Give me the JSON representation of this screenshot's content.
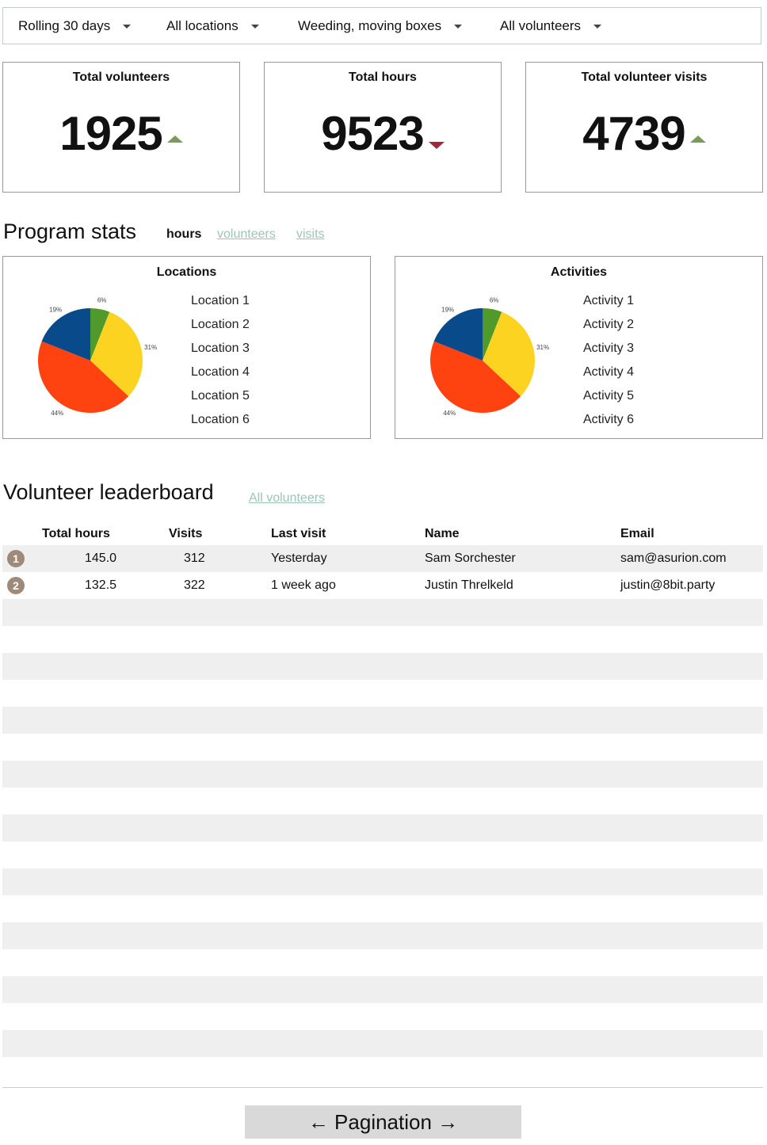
{
  "filters": [
    {
      "label": "Rolling 30 days"
    },
    {
      "label": "All locations"
    },
    {
      "label": "Weeding, moving boxes"
    },
    {
      "label": "All volunteers"
    }
  ],
  "stats": [
    {
      "title": "Total volunteers",
      "value": "1925",
      "trend": "up"
    },
    {
      "title": "Total hours",
      "value": "9523",
      "trend": "down"
    },
    {
      "title": "Total volunteer visits",
      "value": "4739",
      "trend": "up"
    }
  ],
  "program_stats": {
    "title": "Program stats",
    "tabs": [
      {
        "label": "hours",
        "active": true
      },
      {
        "label": "volunteers",
        "active": false
      },
      {
        "label": "visits",
        "active": false
      }
    ],
    "locations": {
      "title": "Locations",
      "legend": [
        "Location 1",
        "Location 2",
        "Location 3",
        "Location 4",
        "Location 5",
        "Location 6"
      ],
      "slices": [
        {
          "label": "6%",
          "value": 6,
          "color": "#4f9a2a"
        },
        {
          "label": "31%",
          "value": 31,
          "color": "#fdd322"
        },
        {
          "label": "44%",
          "value": 44,
          "color": "#fe4310"
        },
        {
          "label": "19%",
          "value": 19,
          "color": "#094a8a"
        }
      ]
    },
    "activities": {
      "title": "Activities",
      "legend": [
        "Activity 1",
        "Activity 2",
        "Activity 3",
        "Activity 4",
        "Activity 5",
        "Activity 6"
      ],
      "slices": [
        {
          "label": "6%",
          "value": 6,
          "color": "#4f9a2a"
        },
        {
          "label": "31%",
          "value": 31,
          "color": "#fdd322"
        },
        {
          "label": "44%",
          "value": 44,
          "color": "#fe4310"
        },
        {
          "label": "19%",
          "value": 19,
          "color": "#094a8a"
        }
      ]
    }
  },
  "leaderboard": {
    "title": "Volunteer leaderboard",
    "link": "All volunteers",
    "headers": {
      "total_hours": "Total hours",
      "visits": "Visits",
      "last_visit": "Last visit",
      "name": "Name",
      "email": "Email"
    },
    "rows": [
      {
        "rank": "1",
        "hours": "145.0",
        "visits": "312",
        "last_visit": "Yesterday",
        "name": "Sam Sorchester",
        "email": "sam@asurion.com"
      },
      {
        "rank": "2",
        "hours": "132.5",
        "visits": "322",
        "last_visit": "1 week ago",
        "name": "Justin Threlkeld",
        "email": "justin@8bit.party"
      }
    ]
  },
  "pagination": {
    "label": "← Pagination →"
  }
}
